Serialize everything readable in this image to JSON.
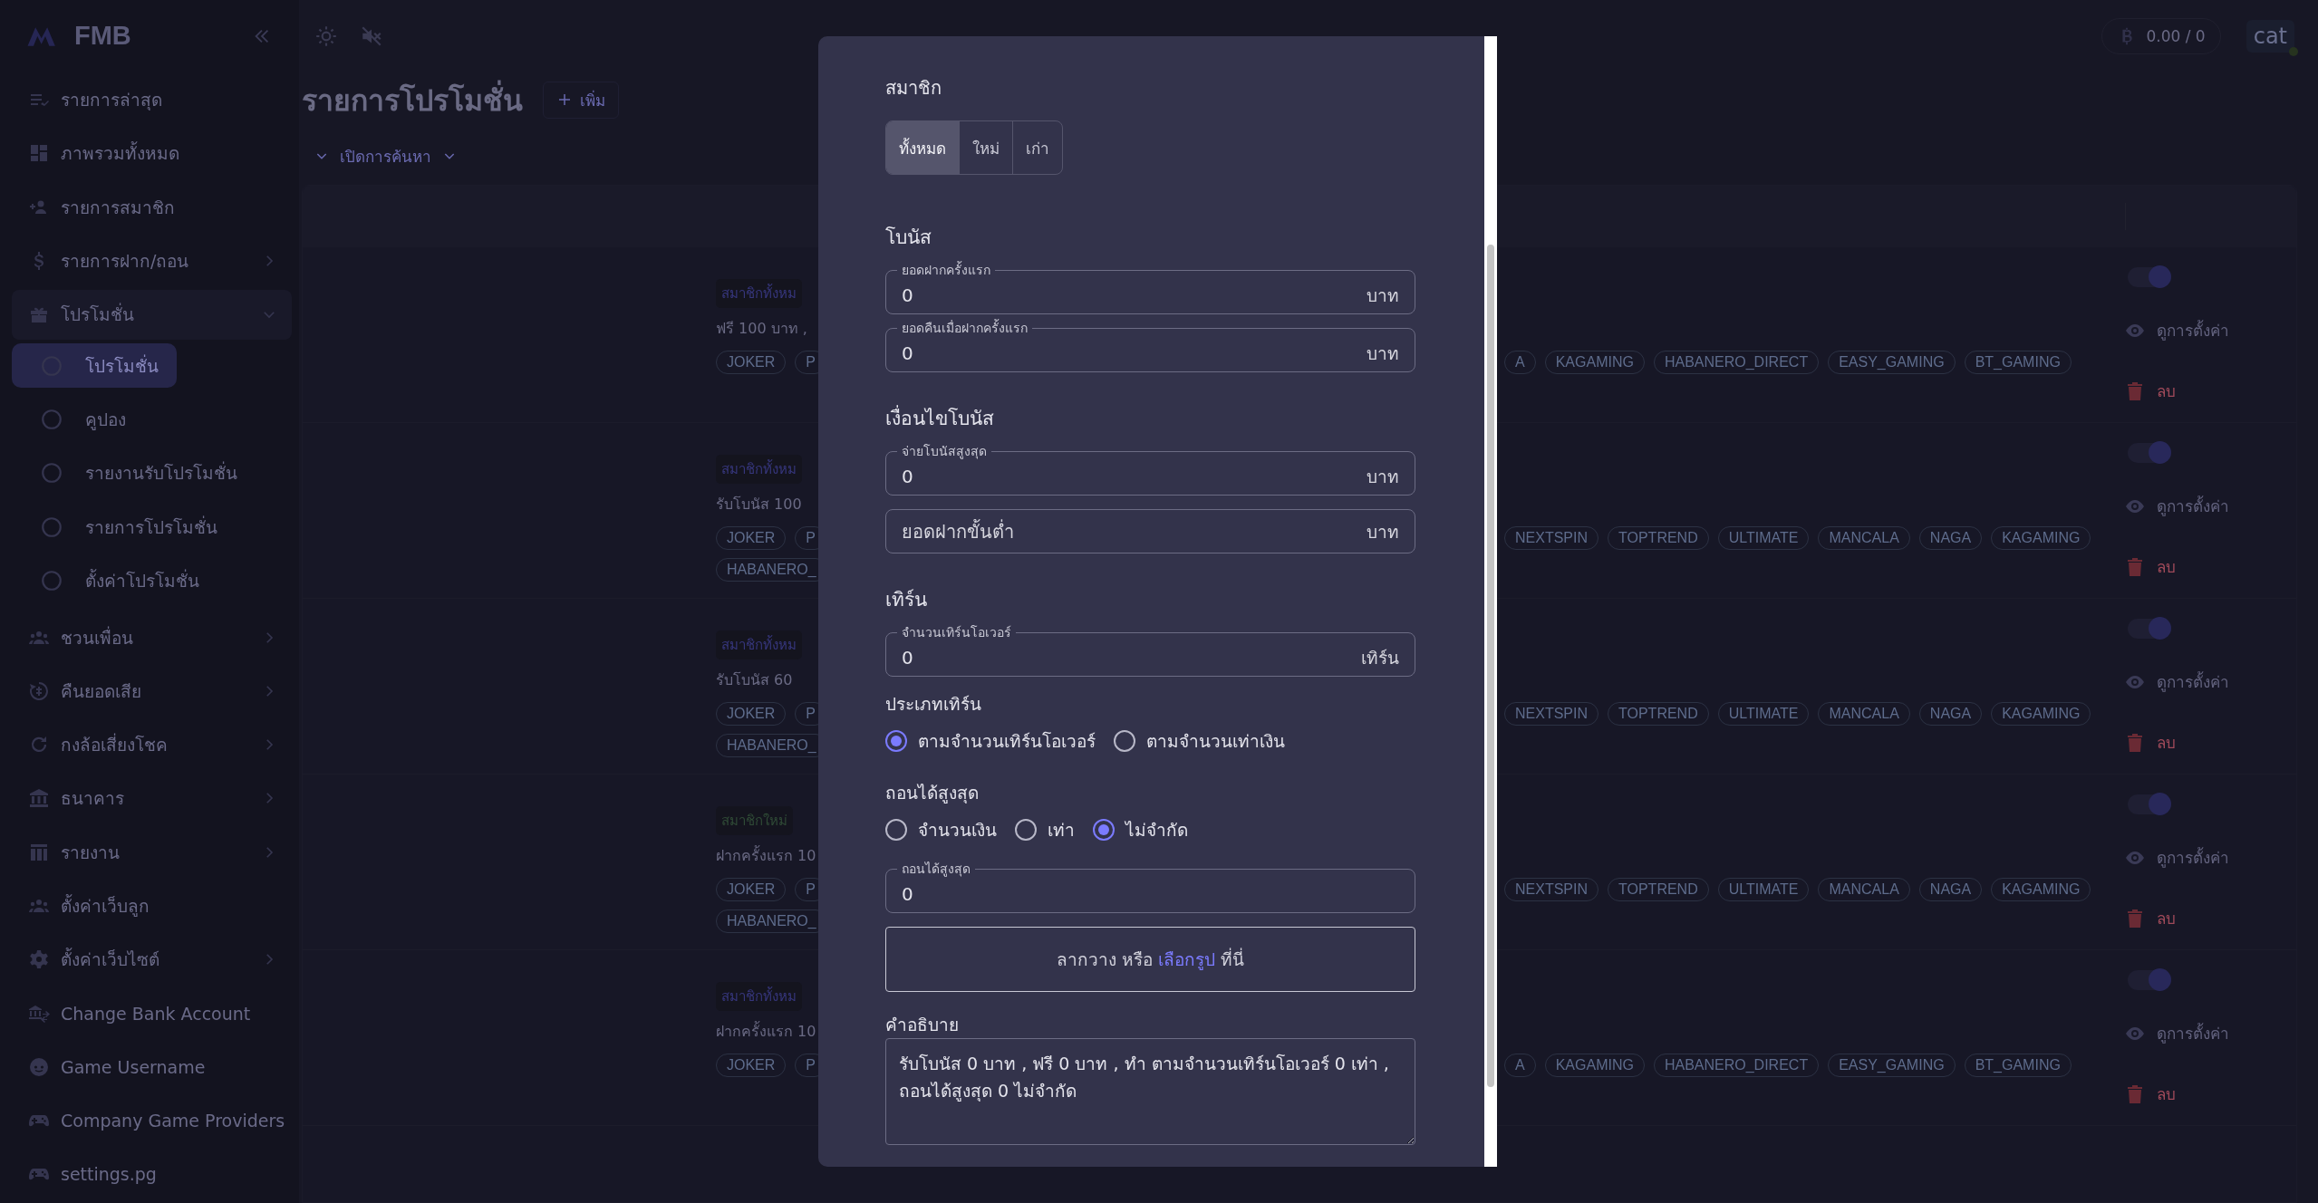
{
  "sidebar": {
    "logo": "FMB",
    "items": [
      {
        "label": "รายการล่าสุด",
        "kind": "list",
        "has_submenu": false
      },
      {
        "label": "ภาพรวมทั้งหมด",
        "kind": "grid",
        "has_submenu": false
      },
      {
        "label": "รายการสมาชิก",
        "kind": "add-user",
        "has_submenu": false
      },
      {
        "label": "รายการฝาก/ถอน",
        "kind": "dollar",
        "has_submenu": true,
        "expanded": false
      },
      {
        "label": "โปรโมชั่น",
        "kind": "gift",
        "has_submenu": true,
        "expanded": true,
        "children": [
          {
            "label": "โปรโมชั่น",
            "selected": true
          },
          {
            "label": "คูปอง",
            "selected": false
          },
          {
            "label": "รายงานรับโปรโมชั่น",
            "selected": false
          },
          {
            "label": "รายการโปรโมชั่น",
            "selected": false
          },
          {
            "label": "ตั้งค่าโปรโมชั่น",
            "selected": false
          }
        ]
      },
      {
        "label": "ชวนเพื่อน",
        "kind": "group",
        "has_submenu": true,
        "expanded": false
      },
      {
        "label": "คืนยอดเสีย",
        "kind": "refund",
        "has_submenu": true,
        "expanded": false
      },
      {
        "label": "กงล้อเสี่ยงโชค",
        "kind": "refresh",
        "has_submenu": true,
        "expanded": false
      },
      {
        "label": "ธนาคาร",
        "kind": "bank",
        "has_submenu": true,
        "expanded": false
      },
      {
        "label": "รายงาน",
        "kind": "columns",
        "has_submenu": true,
        "expanded": false
      },
      {
        "label": "ตั้งค่าเว็บลูก",
        "kind": "group",
        "has_submenu": false
      },
      {
        "label": "ตั้งค่าเว็บไซต์",
        "kind": "gear",
        "has_submenu": true,
        "expanded": false
      },
      {
        "label": "Change Bank Account",
        "kind": "bank-swap",
        "has_submenu": false
      },
      {
        "label": "Game Username",
        "kind": "face",
        "has_submenu": false
      },
      {
        "label": "Company Game Providers",
        "kind": "gamepad",
        "has_submenu": false
      },
      {
        "label": "settings.pg",
        "kind": "gamepad",
        "has_submenu": false
      }
    ]
  },
  "header": {
    "balance": "0.00 / 0",
    "user": "cat",
    "online": true
  },
  "page": {
    "title": "รายการโปรโมชั่น",
    "add_button": "เพิ่ม",
    "search_toggle": "เปิดการค้นหา"
  },
  "table": {
    "rows": [
      {
        "tag": {
          "text": "สมาชิกทั้งหม",
          "color": "#36367c"
        },
        "description": "ฟรี 100 บาท ,",
        "providers": [
          [
            "JOKER",
            "P"
          ]
        ],
        "providers_right": [
          "A",
          "KAGAMING",
          "HABANERO_DIRECT",
          "EASY_GAMING",
          "BT_GAMING"
        ],
        "enabled": true,
        "view": "ดูการตั้งค่า",
        "delete": "ลบ"
      },
      {
        "tag": {
          "text": "สมาชิกทั้งหม",
          "color": "#36367c"
        },
        "description": "รับโบนัส 100",
        "providers": [
          [
            "JOKER",
            "P"
          ],
          [
            "HABANERO_"
          ]
        ],
        "providers_right": [
          "NEXTSPIN",
          "TOPTREND",
          "ULTIMATE",
          "MANCALA",
          "NAGA",
          "KAGAMING"
        ],
        "enabled": true,
        "view": "ดูการตั้งค่า",
        "delete": "ลบ"
      },
      {
        "tag": {
          "text": "สมาชิกทั้งหม",
          "color": "#36367c"
        },
        "description": "รับโบนัส 60",
        "providers": [
          [
            "JOKER",
            "P"
          ],
          [
            "HABANERO_"
          ]
        ],
        "providers_right": [
          "NEXTSPIN",
          "TOPTREND",
          "ULTIMATE",
          "MANCALA",
          "NAGA",
          "KAGAMING"
        ],
        "enabled": true,
        "view": "ดูการตั้งค่า",
        "delete": "ลบ"
      },
      {
        "tag": {
          "text": "สมาชิกใหม่",
          "color": "#2f4a36"
        },
        "description": "ฝากครั้งแรก 10",
        "providers": [
          [
            "JOKER",
            "P"
          ],
          [
            "HABANERO_"
          ]
        ],
        "providers_right": [
          "NEXTSPIN",
          "TOPTREND",
          "ULTIMATE",
          "MANCALA",
          "NAGA",
          "KAGAMING"
        ],
        "enabled": true,
        "view": "ดูการตั้งค่า",
        "delete": "ลบ"
      },
      {
        "tag": {
          "text": "สมาชิกทั้งหม",
          "color": "#36367c"
        },
        "description": "ฝากครั้งแรก 10",
        "providers": [
          [
            "JOKER",
            "P"
          ]
        ],
        "providers_right": [
          "A",
          "KAGAMING",
          "HABANERO_DIRECT",
          "EASY_GAMING",
          "BT_GAMING"
        ],
        "enabled": true,
        "view": "ดูการตั้งค่า",
        "delete": "ลบ"
      }
    ]
  },
  "modal": {
    "member": {
      "label": "สมาชิก",
      "options": [
        {
          "label": "ทั้งหมด",
          "selected": true
        },
        {
          "label": "ใหม่",
          "selected": false
        },
        {
          "label": "เก่า",
          "selected": false
        }
      ]
    },
    "sections": [
      {
        "heading": "โบนัส",
        "fields": [
          {
            "label": "ยอดฝากครั้งแรก",
            "value": "0",
            "unit": "บาท"
          },
          {
            "label": "ยอดคืนเมื่อฝากครั้งแรก",
            "value": "0",
            "unit": "บาท"
          }
        ]
      },
      {
        "heading": "เงื่อนไขโบนัส",
        "fields": [
          {
            "label": "จ่ายโบนัสสูงสุด",
            "value": "0",
            "unit": "บาท"
          },
          {
            "placeholder": "ยอดฝากขั้นต่ำ",
            "unit": "บาท"
          }
        ]
      },
      {
        "heading": "เทิร์น",
        "fields": [
          {
            "label": "จำนวนเทิร์นโอเวอร์",
            "value": "0",
            "unit": "เทิร์น"
          }
        ]
      }
    ],
    "turn_type": {
      "label": "ประเภทเทิร์น",
      "options": [
        {
          "label": "ตามจำนวนเทิร์นโอเวอร์",
          "selected": true
        },
        {
          "label": "ตามจำนวนเท่าเงิน",
          "selected": false
        }
      ]
    },
    "max_withdraw": {
      "label": "ถอนได้สูงสุด",
      "options": [
        {
          "label": "จำนวนเงิน",
          "selected": false
        },
        {
          "label": "เท่า",
          "selected": false
        },
        {
          "label": "ไม่จำกัด",
          "selected": true
        }
      ],
      "field": {
        "label": "ถอนได้สูงสุด",
        "value": "0"
      }
    },
    "dropzone": {
      "before": "ลากวาง หรือ",
      "link": "เลือกรูป",
      "after": "ที่นี่"
    },
    "description": {
      "label": "คำอธิบาย",
      "value": "รับโบนัส 0 บาท , ฟรี 0 บาท , ทำ ตามจำนวนเทิร์นโอเวอร์ 0 เท่า , ถอนได้สูงสุด 0 ไม่จำกัด"
    }
  }
}
